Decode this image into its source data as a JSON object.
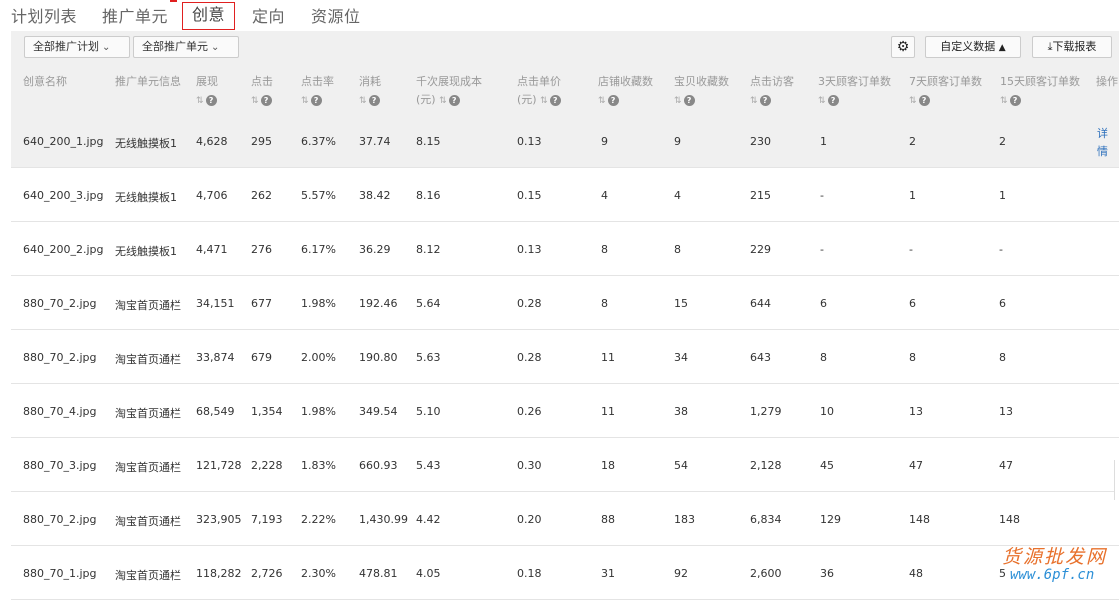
{
  "tabs": [
    {
      "label": "计划列表",
      "active": false
    },
    {
      "label": "推广单元",
      "active": false
    },
    {
      "label": "创意",
      "active": true
    },
    {
      "label": "定向",
      "active": false
    },
    {
      "label": "资源位",
      "active": false
    }
  ],
  "filters": {
    "plan": "全部推广计划",
    "unit": "全部推广单元"
  },
  "toolbar": {
    "custom_data": "自定义数据",
    "download": "下载报表"
  },
  "columns": [
    "创意名称",
    "推广单元信息",
    "展现",
    "点击",
    "点击率",
    "消耗",
    "千次展现成本",
    "点击单价",
    "店铺收藏数",
    "宝贝收藏数",
    "点击访客",
    "3天顾客订单数",
    "7天顾客订单数",
    "15天顾客订单数",
    "操作"
  ],
  "column_units": {
    "cpm": "(元)",
    "cpc": "(元)"
  },
  "detail_label": "详情",
  "rows": [
    [
      "640_200_1.jpg",
      "无线触摸板1",
      "4,628",
      "295",
      "6.37%",
      "37.74",
      "8.15",
      "0.13",
      "9",
      "9",
      "230",
      "1",
      "2",
      "2"
    ],
    [
      "640_200_3.jpg",
      "无线触摸板1",
      "4,706",
      "262",
      "5.57%",
      "38.42",
      "8.16",
      "0.15",
      "4",
      "4",
      "215",
      "-",
      "1",
      "1"
    ],
    [
      "640_200_2.jpg",
      "无线触摸板1",
      "4,471",
      "276",
      "6.17%",
      "36.29",
      "8.12",
      "0.13",
      "8",
      "8",
      "229",
      "-",
      "-",
      "-"
    ],
    [
      "880_70_2.jpg",
      "淘宝首页通栏",
      "34,151",
      "677",
      "1.98%",
      "192.46",
      "5.64",
      "0.28",
      "8",
      "15",
      "644",
      "6",
      "6",
      "6"
    ],
    [
      "880_70_2.jpg",
      "淘宝首页通栏",
      "33,874",
      "679",
      "2.00%",
      "190.80",
      "5.63",
      "0.28",
      "11",
      "34",
      "643",
      "8",
      "8",
      "8"
    ],
    [
      "880_70_4.jpg",
      "淘宝首页通栏",
      "68,549",
      "1,354",
      "1.98%",
      "349.54",
      "5.10",
      "0.26",
      "11",
      "38",
      "1,279",
      "10",
      "13",
      "13"
    ],
    [
      "880_70_3.jpg",
      "淘宝首页通栏",
      "121,728",
      "2,228",
      "1.83%",
      "660.93",
      "5.43",
      "0.30",
      "18",
      "54",
      "2,128",
      "45",
      "47",
      "47"
    ],
    [
      "880_70_2.jpg",
      "淘宝首页通栏",
      "323,905",
      "7,193",
      "2.22%",
      "1,430.99",
      "4.42",
      "0.20",
      "88",
      "183",
      "6,834",
      "129",
      "148",
      "148"
    ],
    [
      "880_70_1.jpg",
      "淘宝首页通栏",
      "118,282",
      "2,726",
      "2.30%",
      "478.81",
      "4.05",
      "0.18",
      "31",
      "92",
      "2,600",
      "36",
      "48",
      "5"
    ]
  ],
  "watermark": {
    "line1": "货源批发网",
    "line2": "www.6pf.cn"
  },
  "colors": {
    "active_tab_border": "#e02020",
    "link": "#2a6ebb",
    "header_bg": "#f0f0f0"
  }
}
